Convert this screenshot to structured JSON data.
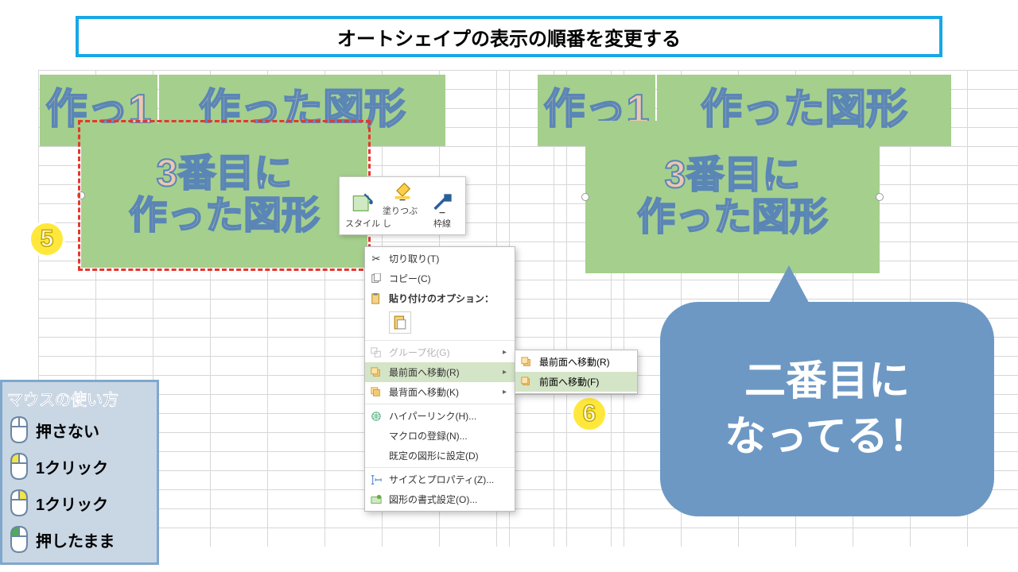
{
  "title": "オートシェイプの表示の順番を変更する",
  "badges": {
    "five": "5",
    "six": "6"
  },
  "shapes": {
    "left_back_a": "作っ1",
    "left_back_b": "作った図形",
    "left_front_line1": "3番目に",
    "left_front_line2": "作った図形",
    "right_back_a": "作っ1",
    "right_back_b": "作った図形",
    "right_front_line1": "3番目に",
    "right_front_line2": "作った図形"
  },
  "mini_toolbar": {
    "style": "スタイル",
    "fill": "塗りつぶし",
    "outline": "枠線"
  },
  "context_menu": {
    "cut": "切り取り(T)",
    "copy": "コピー(C)",
    "paste_options": "貼り付けのオプション：",
    "group": "グループ化(G)",
    "bring_front": "最前面へ移動(R)",
    "send_back": "最背面へ移動(K)",
    "hyperlink": "ハイパーリンク(H)...",
    "assign_macro": "マクロの登録(N)...",
    "set_default": "既定の図形に設定(D)",
    "size_props": "サイズとプロパティ(Z)...",
    "format_shape": "図形の書式設定(O)..."
  },
  "submenu": {
    "bring_to_front": "最前面へ移動(R)",
    "bring_forward": "前面へ移動(F)"
  },
  "callout": "二番目に\nなってる！",
  "legend": {
    "title": "マウスの使い方",
    "none": "押さない",
    "left_click": "1クリック",
    "right_click": "1クリック",
    "hold": "押したまま"
  }
}
